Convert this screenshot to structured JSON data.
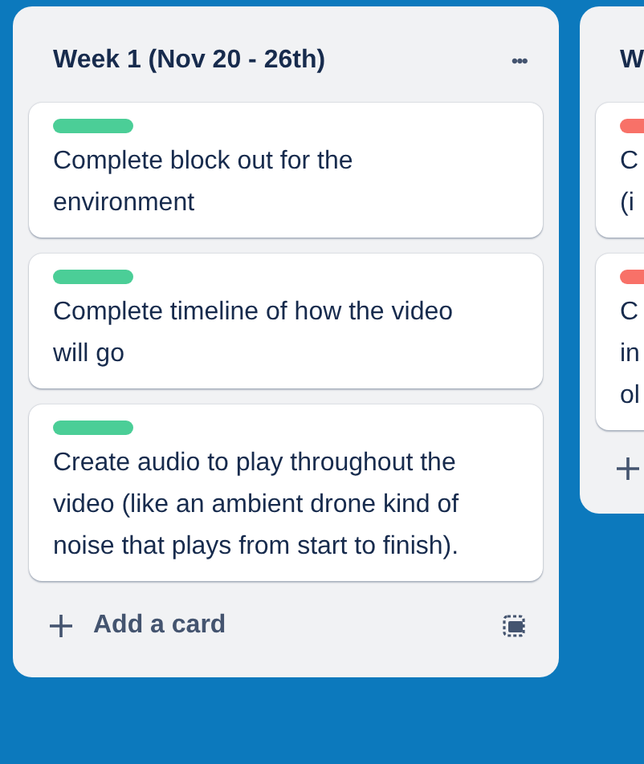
{
  "lists": [
    {
      "title": "Week 1 (Nov 20 - 26th)",
      "menu": "•••",
      "cards": [
        {
          "color": "#4bce97",
          "lines": [
            "Complete block out for the",
            "environment"
          ]
        },
        {
          "color": "#4bce97",
          "lines": [
            "Complete timeline of how the video",
            "will go"
          ]
        },
        {
          "color": "#4bce97",
          "lines": [
            "Create audio to play throughout the",
            "video (like an ambient drone kind of",
            "noise that plays from start to finish)."
          ]
        }
      ],
      "add_label": "Add a card"
    },
    {
      "title": "W",
      "cards": [
        {
          "color": "#f87168",
          "lines": [
            "C",
            "(i"
          ]
        },
        {
          "color": "#f87168",
          "lines": [
            "C",
            "in",
            "ol"
          ]
        }
      ]
    }
  ]
}
